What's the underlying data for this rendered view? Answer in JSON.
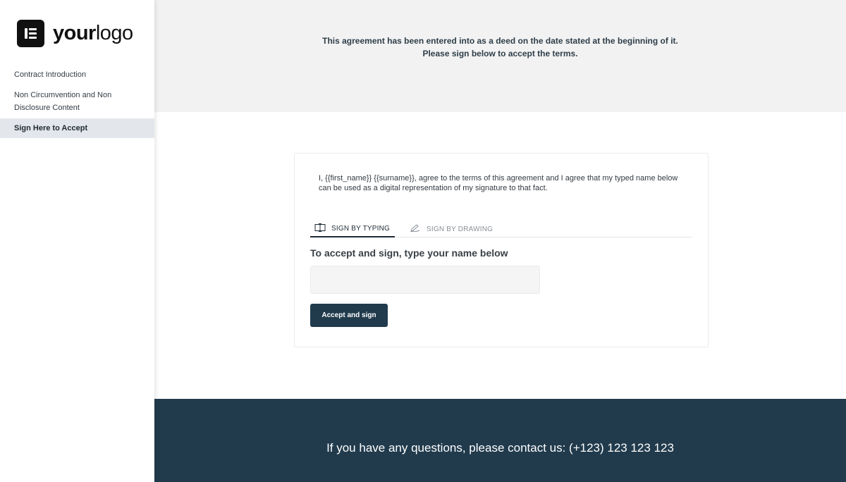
{
  "brand": {
    "logo_text_bold": "your",
    "logo_text_light": "logo",
    "logo_icon": "logo-mark-icon"
  },
  "sidebar": {
    "items": [
      {
        "label": "Contract Introduction",
        "active": false
      },
      {
        "label": "Non Circumvention and Non Disclosure Content",
        "active": false
      },
      {
        "label": "Sign Here to Accept",
        "active": true
      }
    ]
  },
  "header": {
    "line1": "This agreement has been entered into as a deed on the date stated at the beginning of it.",
    "line2": "Please sign below to accept the terms."
  },
  "signature": {
    "agreement_text": "I, {{first_name}} {{surname}}, agree to the terms of this agreement and I agree that my typed name below can be used as a digital representation of my signature to that fact.",
    "tabs": [
      {
        "label": "SIGN BY TYPING",
        "icon": "keyboard-icon",
        "active": true
      },
      {
        "label": "SIGN BY DRAWING",
        "icon": "pen-icon",
        "active": false
      }
    ],
    "title": "To accept and sign, type your name below",
    "input_value": "",
    "input_placeholder": "",
    "button_label": "Accept and sign"
  },
  "footer": {
    "text": "If you have any questions, please contact us: (+123) 123 123 123"
  },
  "colors": {
    "accent": "#213b4d",
    "header_bg": "#f2f2f3",
    "sidebar_active_bg": "#e3e6ea"
  }
}
